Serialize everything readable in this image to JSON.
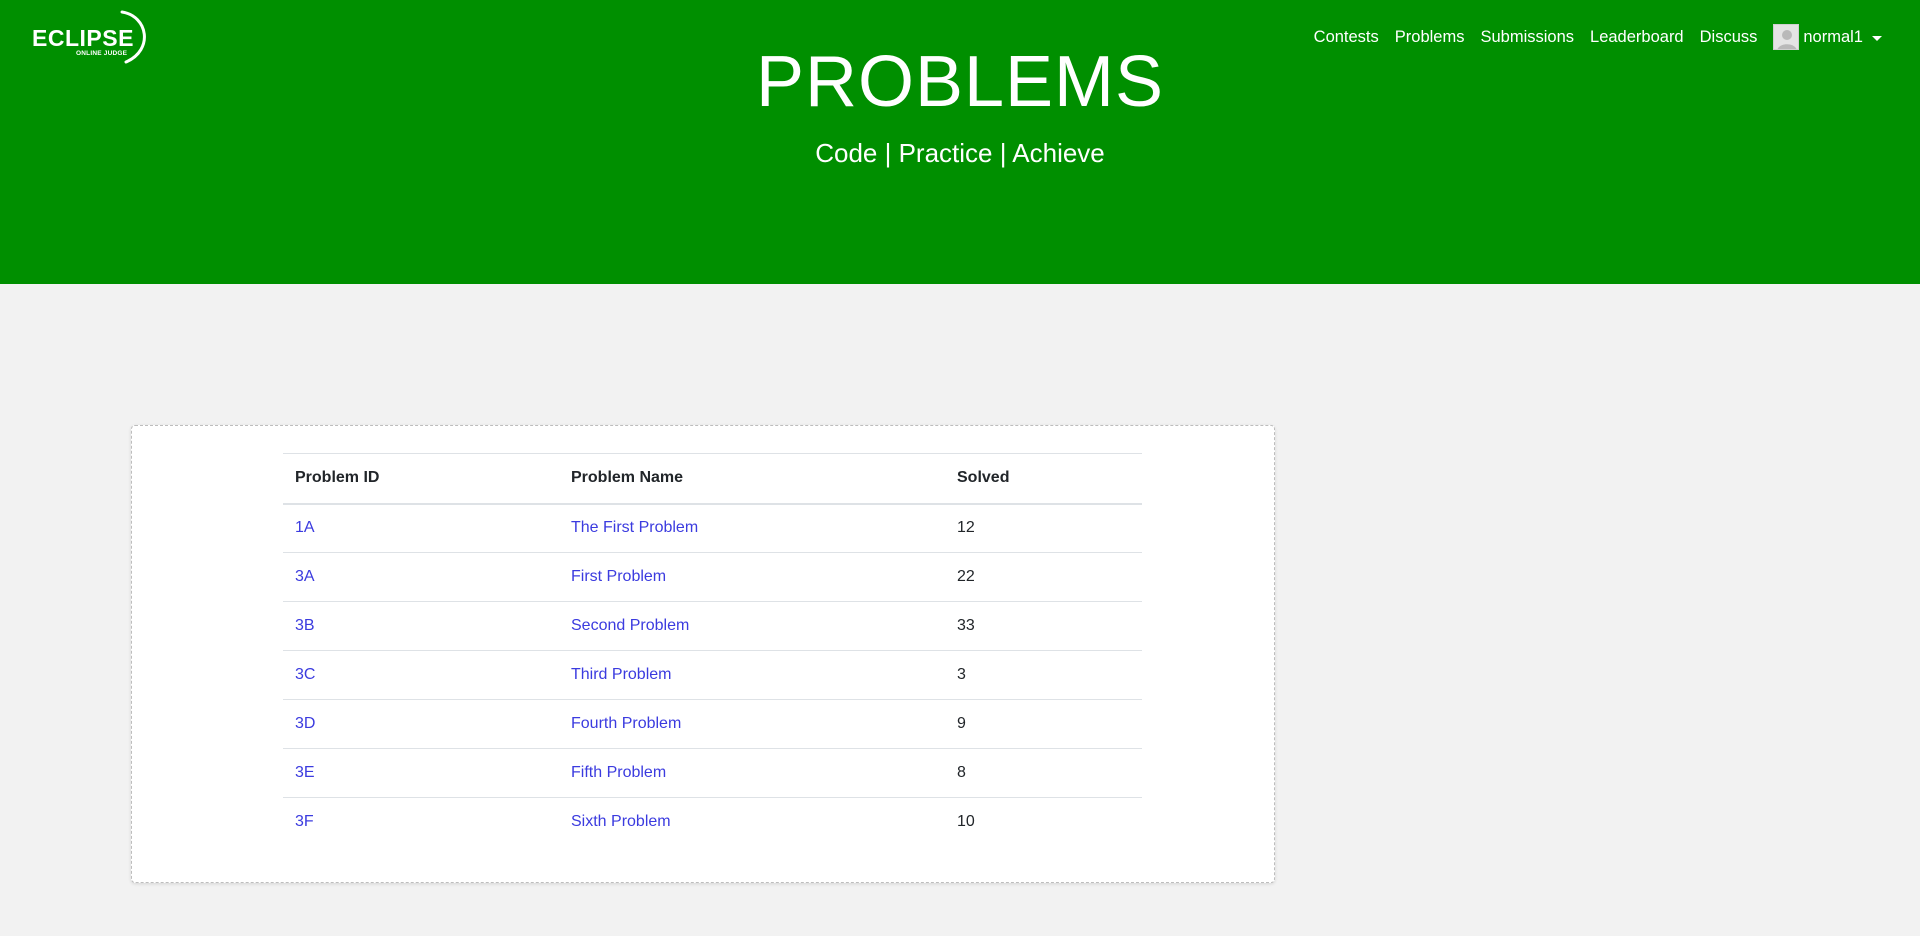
{
  "logo": {
    "word": "ECLIPSE",
    "sub": "ONLINE JUDGE"
  },
  "nav": {
    "items": [
      {
        "label": "Contests"
      },
      {
        "label": "Problems"
      },
      {
        "label": "Submissions"
      },
      {
        "label": "Leaderboard"
      },
      {
        "label": "Discuss"
      }
    ],
    "user": {
      "name": "normal1",
      "avatar_icon": "user-avatar-icon"
    }
  },
  "hero": {
    "title": "PROBLEMS",
    "subtitle": "Code | Practice | Achieve"
  },
  "table": {
    "headers": [
      "Problem ID",
      "Problem Name",
      "Solved"
    ],
    "rows": [
      {
        "id": "1A",
        "name": "The First Problem",
        "solved": "12"
      },
      {
        "id": "3A",
        "name": "First Problem",
        "solved": "22"
      },
      {
        "id": "3B",
        "name": "Second Problem",
        "solved": "33"
      },
      {
        "id": "3C",
        "name": "Third Problem",
        "solved": "3"
      },
      {
        "id": "3D",
        "name": "Fourth Problem",
        "solved": "9"
      },
      {
        "id": "3E",
        "name": "Fifth Problem",
        "solved": "8"
      },
      {
        "id": "3F",
        "name": "Sixth Problem",
        "solved": "10"
      }
    ]
  },
  "colors": {
    "header_bg": "#008f00",
    "page_bg": "#f2f2f2",
    "link": "#3b3bdf"
  }
}
